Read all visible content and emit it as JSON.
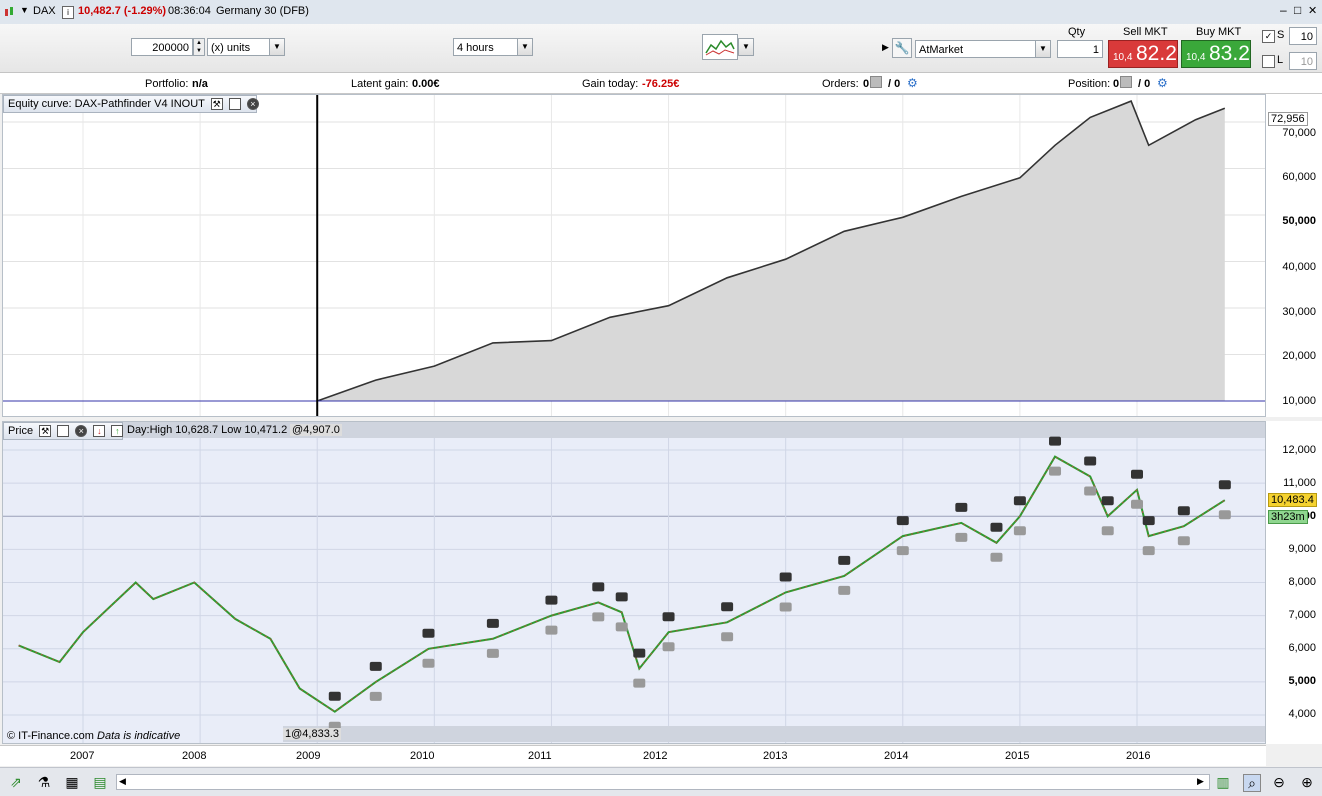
{
  "titlebar": {
    "symbol": "DAX",
    "quote": "10,482.7 (-1.29%)",
    "time": "08:36:04",
    "name": "Germany 30 (DFB)",
    "minimize": "–",
    "maximize": "□",
    "close": "✕"
  },
  "toolbar": {
    "size_value": "200000",
    "units": "(x) units",
    "timeframe": "4 hours",
    "qty_label": "Qty",
    "qty_value": "1",
    "order_type": "AtMarket",
    "sell_label": "Sell MKT",
    "sell_prefix": "10,4",
    "sell_big": "82.2",
    "buy_label": "Buy MKT",
    "buy_prefix": "10,4",
    "buy_big": "83.2",
    "s_label": "S",
    "s_value": "10",
    "l_label": "L",
    "l_value": "10"
  },
  "status": {
    "portfolio_label": "Portfolio:",
    "portfolio_value": "n/a",
    "latent_label": "Latent gain:",
    "latent_value": "0.00€",
    "gain_today_label": "Gain today:",
    "gain_today_value": "-76.25€",
    "orders_label": "Orders:",
    "orders_a": "0",
    "orders_b": "/ 0",
    "position_label": "Position:",
    "position_a": "0",
    "position_b": "/ 0"
  },
  "equity_pane": {
    "header": "Equity curve: DAX-Pathfinder V4 INOUT",
    "last_value": "72,956",
    "ticks": [
      "70,000",
      "60,000",
      "50,000",
      "40,000",
      "30,000",
      "20,000",
      "10,000"
    ]
  },
  "price_pane": {
    "header": "Price",
    "day_info": "Day:High 10,628.7 Low 10,471.2",
    "top_marker": "@4,907.0",
    "bottom_marker": "1@4,833.3",
    "last_price": "10,483.4",
    "countdown": "3h23m",
    "ticks": [
      "12,000",
      "11,000",
      "10,000",
      "9,000",
      "8,000",
      "7,000",
      "6,000",
      "5,000",
      "4,000"
    ],
    "watermark": "© IT-Finance.com",
    "watermark_note": "Data is indicative"
  },
  "dates": [
    "2007",
    "2008",
    "2009",
    "2010",
    "2011",
    "2012",
    "2013",
    "2014",
    "2015",
    "2016"
  ],
  "colors": {
    "sell": "#d93a3a",
    "buy": "#3aa83a",
    "negative": "#cc0000",
    "equity_fill": "#d8d8d8",
    "baseline": "#3333aa"
  },
  "chart_data": [
    {
      "type": "area",
      "title": "Equity curve: DAX-Pathfinder V4 INOUT",
      "x": [
        2009.0,
        2009.5,
        2010.0,
        2010.5,
        2011.0,
        2011.5,
        2012.0,
        2012.5,
        2013.0,
        2013.5,
        2014.0,
        2014.5,
        2015.0,
        2015.3,
        2015.6,
        2015.95,
        2016.1,
        2016.5,
        2016.75
      ],
      "values": [
        10000,
        14500,
        17500,
        22500,
        23000,
        28000,
        30500,
        36500,
        40500,
        46500,
        49500,
        54000,
        58000,
        65000,
        71000,
        74500,
        65000,
        70500,
        72956
      ],
      "ylim": [
        8000,
        75000
      ],
      "baseline": 10000
    },
    {
      "type": "line",
      "title": "Price",
      "x": [
        2006.45,
        2006.8,
        2007.0,
        2007.45,
        2007.6,
        2007.95,
        2008.3,
        2008.6,
        2008.85,
        2009.15,
        2009.5,
        2009.95,
        2010.5,
        2011.0,
        2011.4,
        2011.6,
        2011.75,
        2012.0,
        2012.5,
        2013.0,
        2013.5,
        2014.0,
        2014.5,
        2014.8,
        2015.0,
        2015.3,
        2015.6,
        2015.75,
        2016.0,
        2016.1,
        2016.4,
        2016.75
      ],
      "values": [
        6100,
        5600,
        6500,
        8000,
        7500,
        8000,
        6900,
        6300,
        4800,
        4100,
        5000,
        6000,
        6300,
        7000,
        7400,
        7100,
        5400,
        6500,
        6800,
        7700,
        8200,
        9400,
        9800,
        9200,
        10000,
        11800,
        11200,
        10000,
        10800,
        9400,
        9700,
        10483.4
      ],
      "ylim": [
        3500,
        12600
      ]
    }
  ]
}
